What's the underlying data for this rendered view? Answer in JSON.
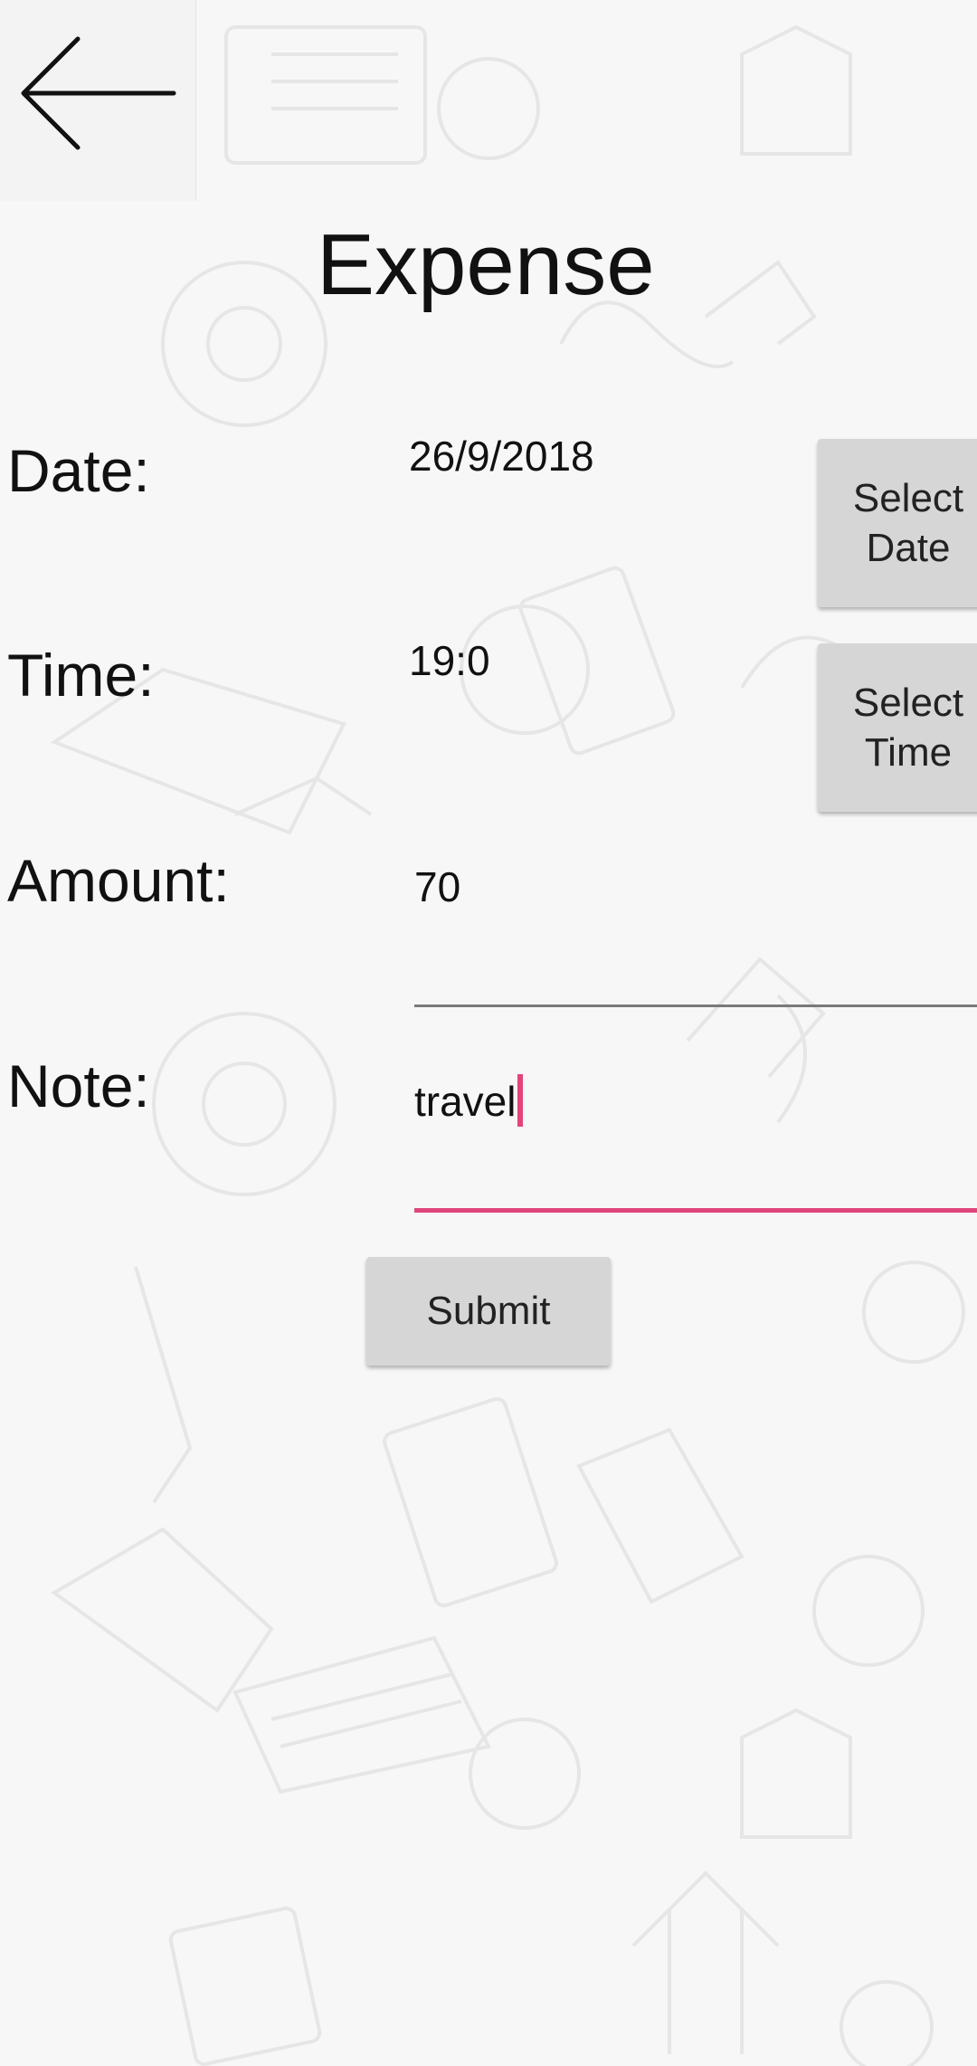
{
  "header": {
    "back_icon": "arrow-left-icon",
    "title": "Expense"
  },
  "form": {
    "date": {
      "label": "Date:",
      "value": "26/9/2018",
      "button_label": "Select Date"
    },
    "time": {
      "label": "Time:",
      "value": "19:0",
      "button_label": "Select Time"
    },
    "amount": {
      "label": "Amount:",
      "value": "70"
    },
    "note": {
      "label": "Note:",
      "value": "travel"
    },
    "submit_label": "Submit"
  },
  "colors": {
    "accent": "#e0457b",
    "button_bg": "#d6d6d6",
    "background": "#f7f7f7"
  }
}
